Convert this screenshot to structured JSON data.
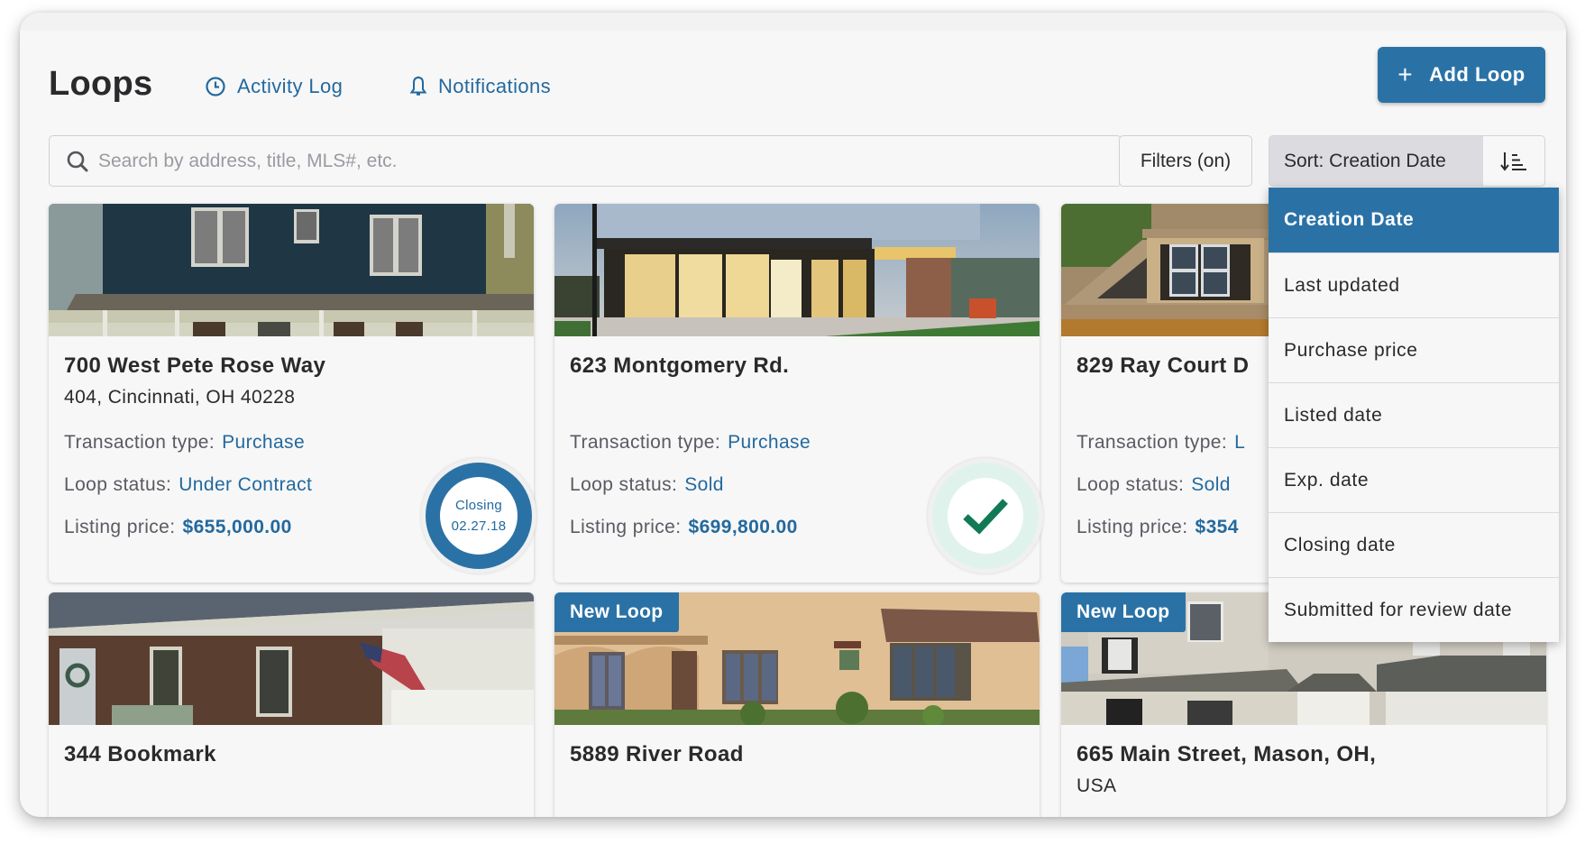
{
  "header": {
    "title": "Loops",
    "nav": [
      {
        "label": "Activity Log",
        "icon": "clock-icon"
      },
      {
        "label": "Notifications",
        "icon": "bell-icon"
      }
    ],
    "add_button": {
      "label": "Add Loop",
      "icon": "+"
    }
  },
  "toolbar": {
    "search_placeholder": "Search by address, title, MLS#, etc.",
    "search_value": "",
    "filters_label": "Filters (on)",
    "sort_label": "Sort: Creation Date",
    "sort_direction_icon": "sort-descending-icon"
  },
  "sort_menu": {
    "selected": "Creation Date",
    "options": [
      "Creation Date",
      "Last updated",
      "Purchase price",
      "Listed date",
      "Exp. date",
      "Closing date",
      "Submitted for review date"
    ]
  },
  "labels": {
    "transaction_type": "Transaction type:",
    "loop_status": "Loop status:",
    "listing_price": "Listing price:",
    "new_loop": "New Loop",
    "closing": "Closing"
  },
  "colors": {
    "accent": "#2a72a6",
    "link": "#23699e",
    "success": "#117a55",
    "success_ring": "#dff3ec"
  },
  "cards": [
    {
      "address_line1": "700 West Pete Rose Way",
      "address_line2": "404, Cincinnati, OH 40228",
      "transaction_type": "Purchase",
      "loop_status": "Under Contract",
      "listing_price": "$655,000.00",
      "badge": {
        "type": "closing",
        "date": "02.27.18"
      },
      "new_loop": false
    },
    {
      "address_line1": "623 Montgomery Rd.",
      "address_line2": "",
      "transaction_type": "Purchase",
      "loop_status": "Sold",
      "listing_price": "$699,800.00",
      "badge": {
        "type": "complete"
      },
      "new_loop": false
    },
    {
      "address_line1": "829 Ray Court D",
      "address_line2": "",
      "transaction_type": "L",
      "loop_status": "Sold",
      "listing_price": "$354",
      "new_loop": false
    },
    {
      "address_line1": "344 Bookmark",
      "address_line2": "",
      "new_loop": false
    },
    {
      "address_line1": "5889 River Road",
      "address_line2": "",
      "new_loop": true
    },
    {
      "address_line1": "665 Main Street, Mason, OH,",
      "address_line2": "USA",
      "new_loop": true
    }
  ]
}
